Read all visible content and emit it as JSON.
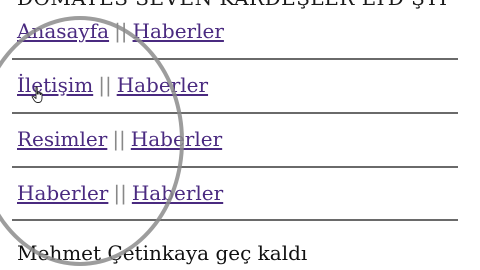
{
  "header": {
    "title": "DOMATES SEVEN KARDEŞLER LTD ŞTİ"
  },
  "nav_rows": [
    {
      "primary": "Anasayfa",
      "separator": "||",
      "secondary": "Haberler"
    },
    {
      "primary": "İletişim",
      "separator": "||",
      "secondary": "Haberler"
    },
    {
      "primary": "Resimler",
      "separator": "||",
      "secondary": "Haberler"
    },
    {
      "primary": "Haberler",
      "separator": "||",
      "secondary": "Haberler"
    }
  ],
  "footer": {
    "note": "Mehmet Çetinkaya geç kaldı"
  },
  "colors": {
    "link": "#4a2a80",
    "rule": "#6a6a6a",
    "annotation_circle": "#8c8c8c"
  },
  "icons": {
    "cursor": "hand-pointer-icon"
  }
}
